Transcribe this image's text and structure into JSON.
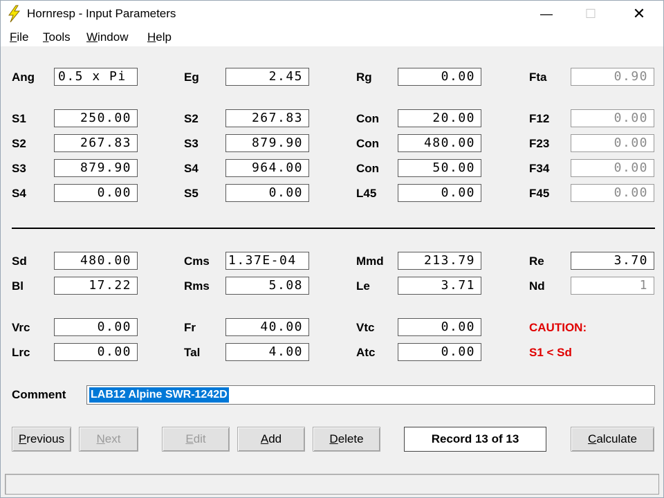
{
  "window": {
    "title": "Hornresp - Input Parameters"
  },
  "menu": [
    {
      "key": "F",
      "rest": "ile"
    },
    {
      "key": "T",
      "rest": "ools"
    },
    {
      "key": "W",
      "rest": "indow"
    },
    {
      "key": "H",
      "rest": "elp"
    }
  ],
  "rows": {
    "ang": {
      "label": "Ang",
      "value": "0.5 x Pi"
    },
    "eg": {
      "label": "Eg",
      "value": "2.45"
    },
    "rg": {
      "label": "Rg",
      "value": "0.00"
    },
    "fta": {
      "label": "Fta",
      "value": "0.90"
    },
    "r1a": {
      "label": "S1",
      "value": "250.00"
    },
    "r1b": {
      "label": "S2",
      "value": "267.83"
    },
    "r1c": {
      "label": "Con",
      "value": "20.00"
    },
    "r1d": {
      "label": "F12",
      "value": "0.00"
    },
    "r2a": {
      "label": "S2",
      "value": "267.83"
    },
    "r2b": {
      "label": "S3",
      "value": "879.90"
    },
    "r2c": {
      "label": "Con",
      "value": "480.00"
    },
    "r2d": {
      "label": "F23",
      "value": "0.00"
    },
    "r3a": {
      "label": "S3",
      "value": "879.90"
    },
    "r3b": {
      "label": "S4",
      "value": "964.00"
    },
    "r3c": {
      "label": "Con",
      "value": "50.00"
    },
    "r3d": {
      "label": "F34",
      "value": "0.00"
    },
    "r4a": {
      "label": "S4",
      "value": "0.00"
    },
    "r4b": {
      "label": "S5",
      "value": "0.00"
    },
    "r4c": {
      "label": "L45",
      "value": "0.00"
    },
    "r4d": {
      "label": "F45",
      "value": "0.00"
    },
    "sd": {
      "label": "Sd",
      "value": "480.00"
    },
    "cms": {
      "label": "Cms",
      "value": "1.37E-04"
    },
    "mmd": {
      "label": "Mmd",
      "value": "213.79"
    },
    "re": {
      "label": "Re",
      "value": "3.70"
    },
    "bl": {
      "label": "Bl",
      "value": "17.22"
    },
    "rms": {
      "label": "Rms",
      "value": "5.08"
    },
    "le": {
      "label": "Le",
      "value": "3.71"
    },
    "nd": {
      "label": "Nd",
      "value": "1"
    },
    "vrc": {
      "label": "Vrc",
      "value": "0.00"
    },
    "fr": {
      "label": "Fr",
      "value": "40.00"
    },
    "vtc": {
      "label": "Vtc",
      "value": "0.00"
    },
    "lrc": {
      "label": "Lrc",
      "value": "0.00"
    },
    "tal": {
      "label": "Tal",
      "value": "4.00"
    },
    "atc": {
      "label": "Atc",
      "value": "0.00"
    }
  },
  "caution": {
    "title": "CAUTION:",
    "message": "S1 < Sd",
    "color": "#e00000"
  },
  "comment": {
    "label": "Comment",
    "value": "LAB12 Alpine SWR-1242D"
  },
  "buttons": {
    "previous": {
      "key": "P",
      "rest": "revious"
    },
    "next": {
      "key": "N",
      "rest": "ext"
    },
    "edit": {
      "key": "E",
      "rest": "dit"
    },
    "add": {
      "key": "A",
      "rest": "dd"
    },
    "delete": {
      "key": "D",
      "rest": "elete"
    },
    "calculate": {
      "key": "C",
      "rest": "alculate"
    }
  },
  "record": "Record 13 of 13"
}
